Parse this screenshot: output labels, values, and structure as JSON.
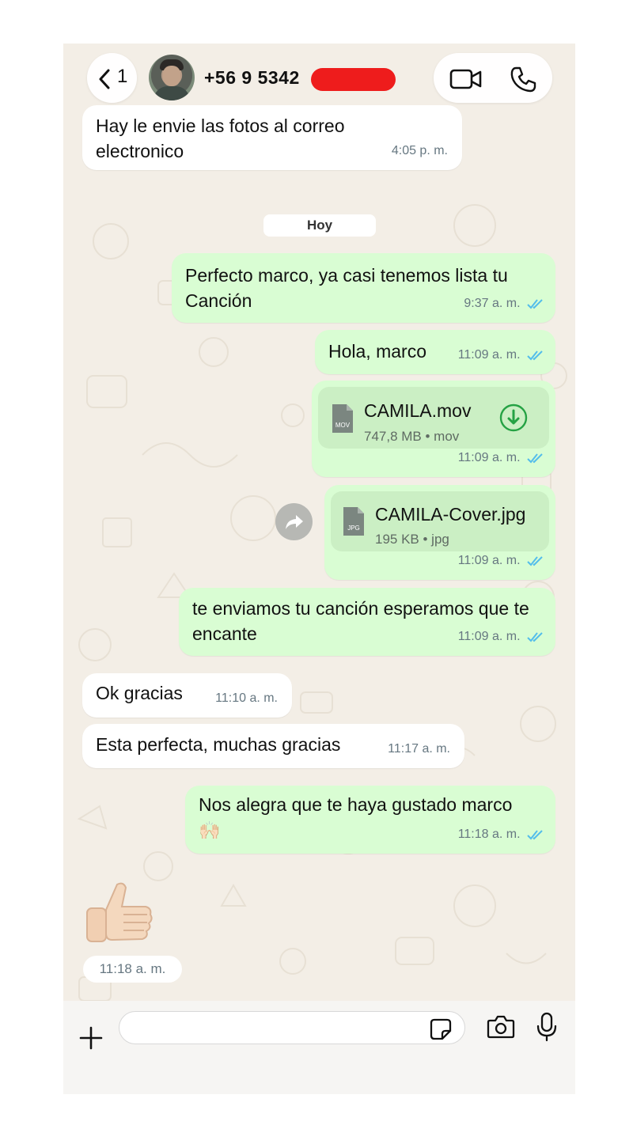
{
  "header": {
    "back_count": "1",
    "contact_name": "+56 9 5342",
    "icons": [
      "chevron-left-icon",
      "video-call-icon",
      "phone-icon"
    ]
  },
  "messages": [
    {
      "dir": "in",
      "text": "Hay le envie las fotos al correo electronico",
      "time": "4:05 p. m."
    },
    {
      "dir": "out",
      "text": "Perfecto marco, ya casi tenemos lista tu Canción",
      "time": "9:37 a. m."
    },
    {
      "dir": "out",
      "text": "Hola, marco",
      "time": "11:09 a. m."
    },
    {
      "dir": "out",
      "type": "file",
      "file_ext": "MOV",
      "file_name": "CAMILA.mov",
      "file_info": "747,8 MB • mov",
      "time": "11:09 a. m."
    },
    {
      "dir": "out",
      "type": "file",
      "file_ext": "JPG",
      "file_name": "CAMILA-Cover.jpg",
      "file_info": "195 KB • jpg",
      "time": "11:09 a. m."
    },
    {
      "dir": "out",
      "text": "te enviamos tu canción esperamos que te encante",
      "time": "11:09 a. m."
    },
    {
      "dir": "in",
      "text": "Ok gracias",
      "time": "11:10 a. m."
    },
    {
      "dir": "in",
      "text": "Esta perfecta, muchas gracias",
      "time": "11:17 a. m."
    },
    {
      "dir": "out",
      "text": "Nos alegra que te haya gustado marco",
      "emoji": "🙌🏻",
      "time": "11:18 a. m."
    },
    {
      "dir": "in",
      "type": "sticker",
      "emoji": "👍🏻",
      "time": "11:18 a. m."
    }
  ],
  "date_divider": "Hoy",
  "input": {
    "value": "",
    "placeholder": ""
  },
  "colors": {
    "outgoing_bubble": "#d9fdd3",
    "incoming_bubble": "#ffffff",
    "read_ticks": "#53bdeb",
    "download_green": "#25a244",
    "redaction": "#ee1c1c",
    "chat_background": "#f3eee6"
  }
}
